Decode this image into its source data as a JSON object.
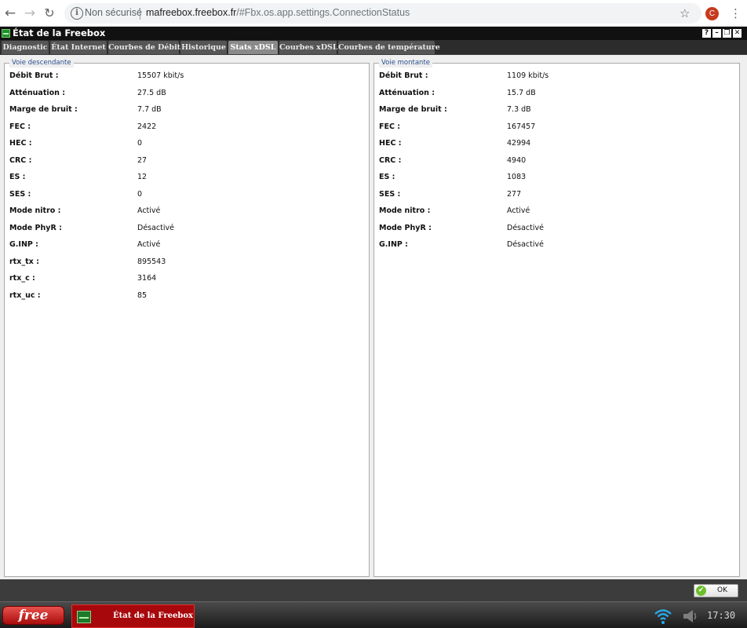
{
  "browser": {
    "security_label": "Non sécurisé",
    "url_host": "mafreebox.freebox.fr",
    "url_path": "/#Fbx.os.app.settings.ConnectionStatus",
    "avatar_letter": "C",
    "icons": {
      "back": "arrow-left-icon",
      "forward": "arrow-right-icon",
      "reload": "reload-icon",
      "info": "info-icon",
      "star": "star-icon",
      "menu": "more-vertical-icon"
    }
  },
  "window": {
    "title": "État de la Freebox",
    "controls": {
      "help": "?",
      "minimize": "–",
      "maximize": "❐",
      "close": "✕"
    },
    "tabs": [
      {
        "label": "Diagnostic"
      },
      {
        "label": "État Internet"
      },
      {
        "label": "Courbes de Débit"
      },
      {
        "label": "Historique"
      },
      {
        "label": "Stats xDSL",
        "active": true
      },
      {
        "label": "Courbes xDSL"
      },
      {
        "label": "Courbes de température"
      }
    ],
    "ok_label": "OK"
  },
  "downstream": {
    "legend": "Voie descendante",
    "rows": [
      {
        "label": "Débit Brut :",
        "value": "15507 kbit/s"
      },
      {
        "label": "Atténuation :",
        "value": "27.5 dB"
      },
      {
        "label": "Marge de bruit :",
        "value": "7.7 dB"
      },
      {
        "label": "FEC :",
        "value": "2422"
      },
      {
        "label": "HEC :",
        "value": "0"
      },
      {
        "label": "CRC :",
        "value": "27"
      },
      {
        "label": "ES :",
        "value": "12"
      },
      {
        "label": "SES :",
        "value": "0"
      },
      {
        "label": "Mode nitro :",
        "value": "Activé"
      },
      {
        "label": "Mode PhyR :",
        "value": "Désactivé"
      },
      {
        "label": "G.INP :",
        "value": "Activé"
      },
      {
        "label": "rtx_tx :",
        "value": "895543"
      },
      {
        "label": "rtx_c :",
        "value": "3164"
      },
      {
        "label": "rtx_uc :",
        "value": "85"
      }
    ]
  },
  "upstream": {
    "legend": "Voie montante",
    "rows": [
      {
        "label": "Débit Brut :",
        "value": "1109 kbit/s"
      },
      {
        "label": "Atténuation :",
        "value": "15.7 dB"
      },
      {
        "label": "Marge de bruit :",
        "value": "7.3 dB"
      },
      {
        "label": "FEC :",
        "value": "167457"
      },
      {
        "label": "HEC :",
        "value": "42994"
      },
      {
        "label": "CRC :",
        "value": "4940"
      },
      {
        "label": "ES :",
        "value": "1083"
      },
      {
        "label": "SES :",
        "value": "277"
      },
      {
        "label": "Mode nitro :",
        "value": "Activé"
      },
      {
        "label": "Mode PhyR :",
        "value": "Désactivé"
      },
      {
        "label": "G.INP :",
        "value": "Désactivé"
      }
    ]
  },
  "taskbar": {
    "logo_text": "free",
    "task_label": "État de la Freebox",
    "clock": "17:30",
    "colors": {
      "logo": "#c8201c",
      "task": "#a7080b"
    }
  }
}
